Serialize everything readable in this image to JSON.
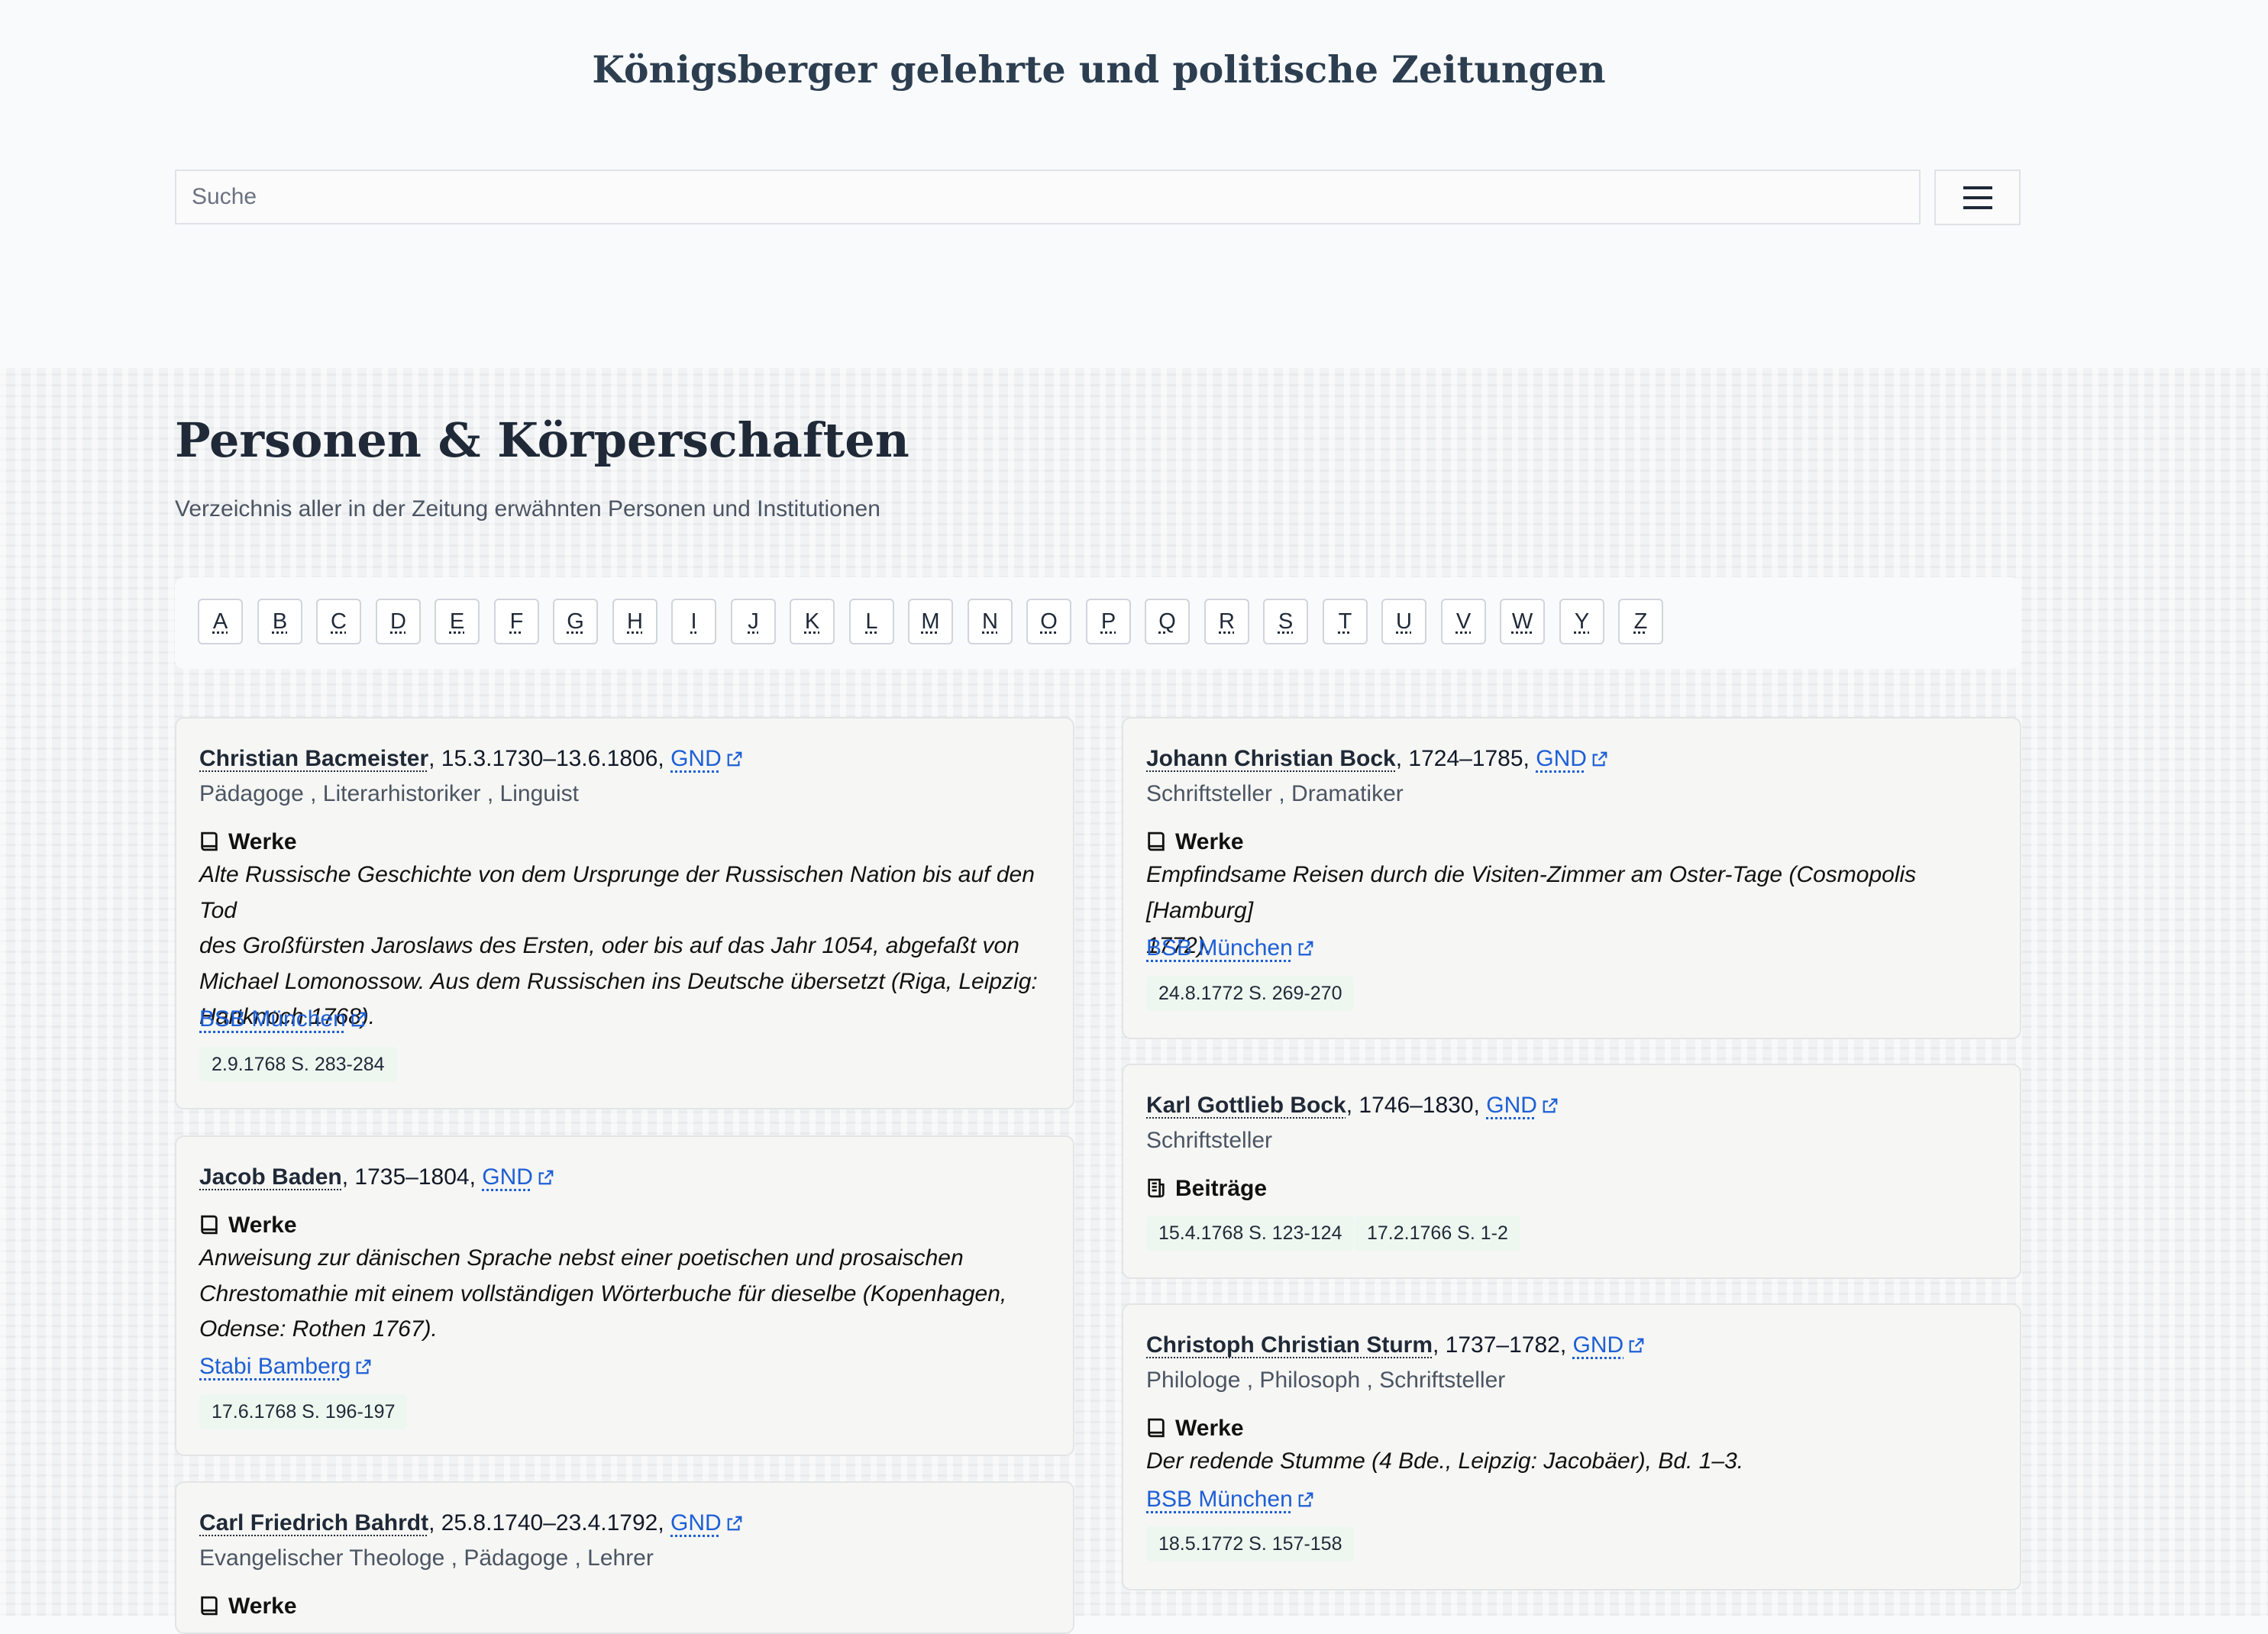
{
  "header": {
    "site_title": "Königsberger gelehrte und politische Zeitungen",
    "search_placeholder": "Suche",
    "menu_icon": "hamburger-menu-icon"
  },
  "page": {
    "title": "Personen & Körperschaften",
    "subtitle": "Verzeichnis aller in der Zeitung erwähnten Personen und Institutionen"
  },
  "alphabet": [
    "A",
    "B",
    "C",
    "D",
    "E",
    "F",
    "G",
    "H",
    "I",
    "J",
    "K",
    "L",
    "M",
    "N",
    "O",
    "P",
    "Q",
    "R",
    "S",
    "T",
    "U",
    "V",
    "W",
    "Y",
    "Z"
  ],
  "labels": {
    "gnd": "GND",
    "werke": "Werke",
    "beitraege": "Beiträge"
  },
  "persons": [
    {
      "name": "Christian Bacmeister",
      "dates": ", 15.3.1730–13.6.1806,",
      "professions": "Pädagoge , Literarhistoriker , Linguist",
      "work_lines": [
        "Alte Russische Geschichte von dem Ursprunge der Russischen Nation bis auf den Tod",
        "des Großfürsten Jaroslaws des Ersten, oder bis auf das Jahr 1054, abgefaßt von",
        "Michael Lomonossow. Aus dem Russischen ins Deutsche übersetzt (Riga, Leipzig:",
        "Hartknoch 1768)."
      ],
      "library": "BSB München",
      "refs": [
        "2.9.1768 S. 283-284"
      ]
    },
    {
      "name": "Jacob Baden",
      "dates": ", 1735–1804,",
      "work_lines": [
        "Anweisung zur dänischen Sprache nebst einer poetischen und prosaischen",
        "Chrestomathie mit einem vollständigen Wörterbuche für dieselbe (Kopenhagen,",
        "Odense: Rothen 1767)."
      ],
      "library": "Stabi Bamberg",
      "refs": [
        "17.6.1768 S. 196-197"
      ]
    },
    {
      "name": "Carl Friedrich Bahrdt",
      "dates": ", 25.8.1740–23.4.1792,",
      "professions": "Evangelischer Theologe , Pädagoge , Lehrer"
    },
    {
      "name": "Johann Christian Bock",
      "dates": ", 1724–1785,",
      "professions": "Schriftsteller , Dramatiker",
      "work_lines": [
        "Empfindsame Reisen durch die Visiten-Zimmer am Oster-Tage (Cosmopolis [Hamburg]",
        "1772)."
      ],
      "library": "BSB München",
      "refs": [
        "24.8.1772 S. 269-270"
      ]
    },
    {
      "name": "Karl Gottlieb Bock",
      "dates": ", 1746–1830,",
      "professions": "Schriftsteller",
      "refs": [
        "15.4.1768 S. 123-124",
        "17.2.1766 S. 1-2"
      ]
    },
    {
      "name": "Christoph Christian Sturm",
      "dates": ", 1737–1782,",
      "professions": "Philologe , Philosoph , Schriftsteller",
      "work_lines": [
        "Der redende Stumme (4 Bde., Leipzig: Jacobäer), Bd. 1–3."
      ],
      "library": "BSB München",
      "refs": [
        "18.5.1772 S. 157-158"
      ]
    }
  ]
}
